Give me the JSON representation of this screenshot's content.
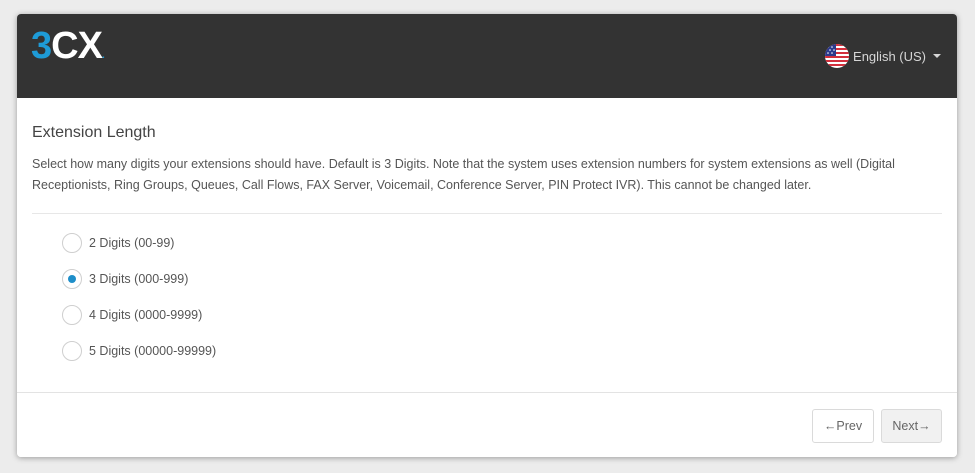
{
  "header": {
    "logo": {
      "three": "3",
      "cx": "CX",
      "dot": "."
    },
    "language": {
      "label": "English (US)",
      "flag_icon": "us-flag-icon"
    }
  },
  "page": {
    "title": "Extension Length",
    "description": "Select how many digits your extensions should have. Default is 3 Digits. Note that the system uses extension numbers for system extensions as well (Digital Receptionists, Ring Groups, Queues, Call Flows, FAX Server, Voicemail, Conference Server, PIN Protect IVR). This cannot be changed later."
  },
  "options": [
    {
      "label": "2 Digits (00-99)",
      "checked": false
    },
    {
      "label": "3 Digits (000-999)",
      "checked": true
    },
    {
      "label": "4 Digits (0000-9999)",
      "checked": false
    },
    {
      "label": "5 Digits (00000-99999)",
      "checked": false
    }
  ],
  "footer": {
    "prev_label": "←Prev",
    "next_label": "Next→"
  },
  "colors": {
    "header_bg": "#333333",
    "brand_blue": "#1e9bd7",
    "radio_checked": "#1e8ec9"
  }
}
